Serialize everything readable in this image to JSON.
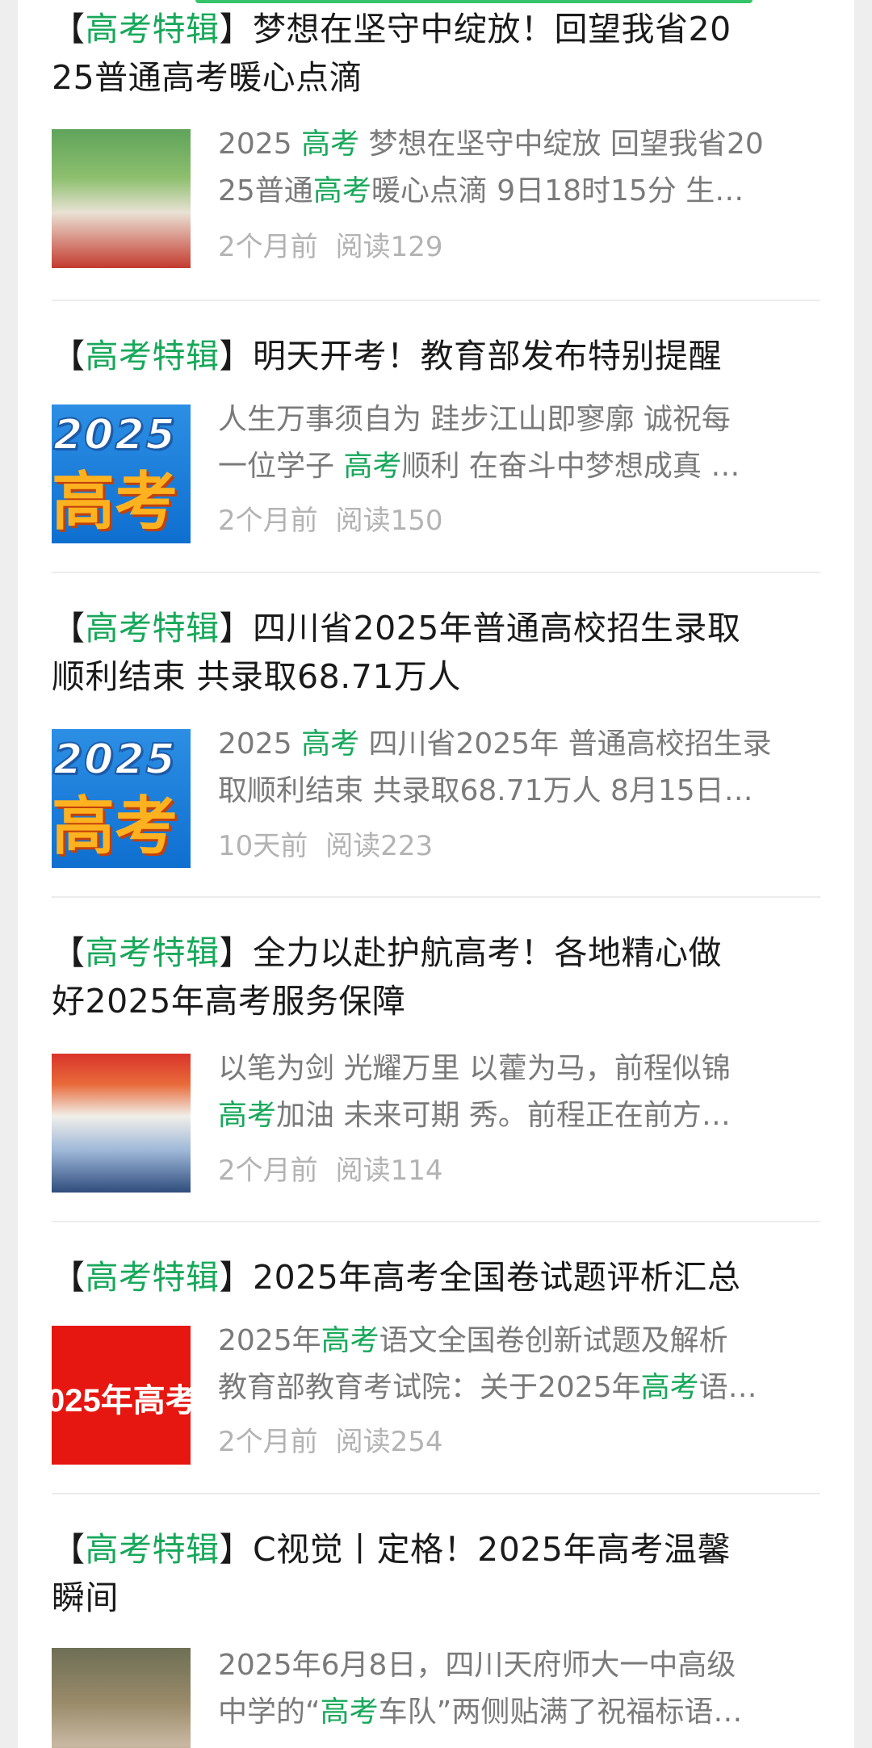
{
  "articles": [
    {
      "title_lines": [
        [
          {
            "t": "【",
            "k": false
          },
          {
            "t": "高考特辑",
            "k": true
          },
          {
            "t": "】梦想在坚守中绽放！回望我省20",
            "k": false
          }
        ],
        [
          {
            "t": "25普通高考暖心点滴",
            "k": false
          }
        ]
      ],
      "thumb": "photo-green",
      "snippet_lines": [
        [
          {
            "t": "2025 ",
            "k": false
          },
          {
            "t": "高考",
            "k": true
          },
          {
            "t": " 梦想在坚守中绽放 回望我省20",
            "k": false
          }
        ],
        [
          {
            "t": "25普通",
            "k": false
          },
          {
            "t": "高考",
            "k": true
          },
          {
            "t": "暖心点滴 9日18时15分 生…",
            "k": false
          }
        ]
      ],
      "time": "2个月前",
      "reads": "阅读129"
    },
    {
      "title_lines": [
        [
          {
            "t": "【",
            "k": false
          },
          {
            "t": "高考特辑",
            "k": true
          },
          {
            "t": "】明天开考！教育部发布特别提醒",
            "k": false
          }
        ]
      ],
      "thumb": "2025",
      "thumb_year": "2025",
      "thumb_word": "高考",
      "snippet_lines": [
        [
          {
            "t": "人生万事须自为 跬步江山即寥廓 诚祝每",
            "k": false
          }
        ],
        [
          {
            "t": "一位学子 ",
            "k": false
          },
          {
            "t": "高考",
            "k": true
          },
          {
            "t": "顺利 在奋斗中梦想成真 …",
            "k": false
          }
        ]
      ],
      "time": "2个月前",
      "reads": "阅读150"
    },
    {
      "title_lines": [
        [
          {
            "t": "【",
            "k": false
          },
          {
            "t": "高考特辑",
            "k": true
          },
          {
            "t": "】四川省2025年普通高校招生录取",
            "k": false
          }
        ],
        [
          {
            "t": "顺利结束 共录取68.71万人",
            "k": false
          }
        ]
      ],
      "thumb": "2025",
      "thumb_year": "2025",
      "thumb_word": "高考",
      "snippet_lines": [
        [
          {
            "t": "2025 ",
            "k": false
          },
          {
            "t": "高考",
            "k": true
          },
          {
            "t": " 四川省2025年 普通高校招生录",
            "k": false
          }
        ],
        [
          {
            "t": "取顺利结束 共录取68.71万人 8月15日…",
            "k": false
          }
        ]
      ],
      "time": "10天前",
      "reads": "阅读223"
    },
    {
      "title_lines": [
        [
          {
            "t": "【",
            "k": false
          },
          {
            "t": "高考特辑",
            "k": true
          },
          {
            "t": "】全力以赴护航高考！各地精心做",
            "k": false
          }
        ],
        [
          {
            "t": "好2025年高考服务保障",
            "k": false
          }
        ]
      ],
      "thumb": "photo-red",
      "snippet_lines": [
        [
          {
            "t": "以笔为剑 光耀万里 以藿为马，前程似锦",
            "k": false
          }
        ],
        [
          {
            "t": "高考",
            "k": true
          },
          {
            "t": "加油 未来可期 秀。前程正在前方…",
            "k": false
          }
        ]
      ],
      "time": "2个月前",
      "reads": "阅读114"
    },
    {
      "title_lines": [
        [
          {
            "t": "【",
            "k": false
          },
          {
            "t": "高考特辑",
            "k": true
          },
          {
            "t": "】2025年高考全国卷试题评析汇总",
            "k": false
          }
        ]
      ],
      "thumb": "red-text",
      "thumb_text": "025年高考",
      "snippet_lines": [
        [
          {
            "t": "2025年",
            "k": false
          },
          {
            "t": "高考",
            "k": true
          },
          {
            "t": "语文全国卷创新试题及解析",
            "k": false
          }
        ],
        [
          {
            "t": "教育部教育考试院：关于2025年",
            "k": false
          },
          {
            "t": "高考",
            "k": true
          },
          {
            "t": "语…",
            "k": false
          }
        ]
      ],
      "time": "2个月前",
      "reads": "阅读254"
    },
    {
      "title_lines": [
        [
          {
            "t": "【",
            "k": false
          },
          {
            "t": "高考特辑",
            "k": true
          },
          {
            "t": "】C视觉丨定格！2025年高考温馨",
            "k": false
          }
        ],
        [
          {
            "t": "瞬间",
            "k": false
          }
        ]
      ],
      "thumb": "photo-crowd",
      "snippet_lines": [
        [
          {
            "t": "2025年6月8日，四川天府师大一中高级",
            "k": false
          }
        ],
        [
          {
            "t": "中学的“",
            "k": false
          },
          {
            "t": "高考",
            "k": true
          },
          {
            "t": "车队”两侧贴满了祝福标语…",
            "k": false
          }
        ]
      ],
      "time": "",
      "reads": ""
    }
  ]
}
